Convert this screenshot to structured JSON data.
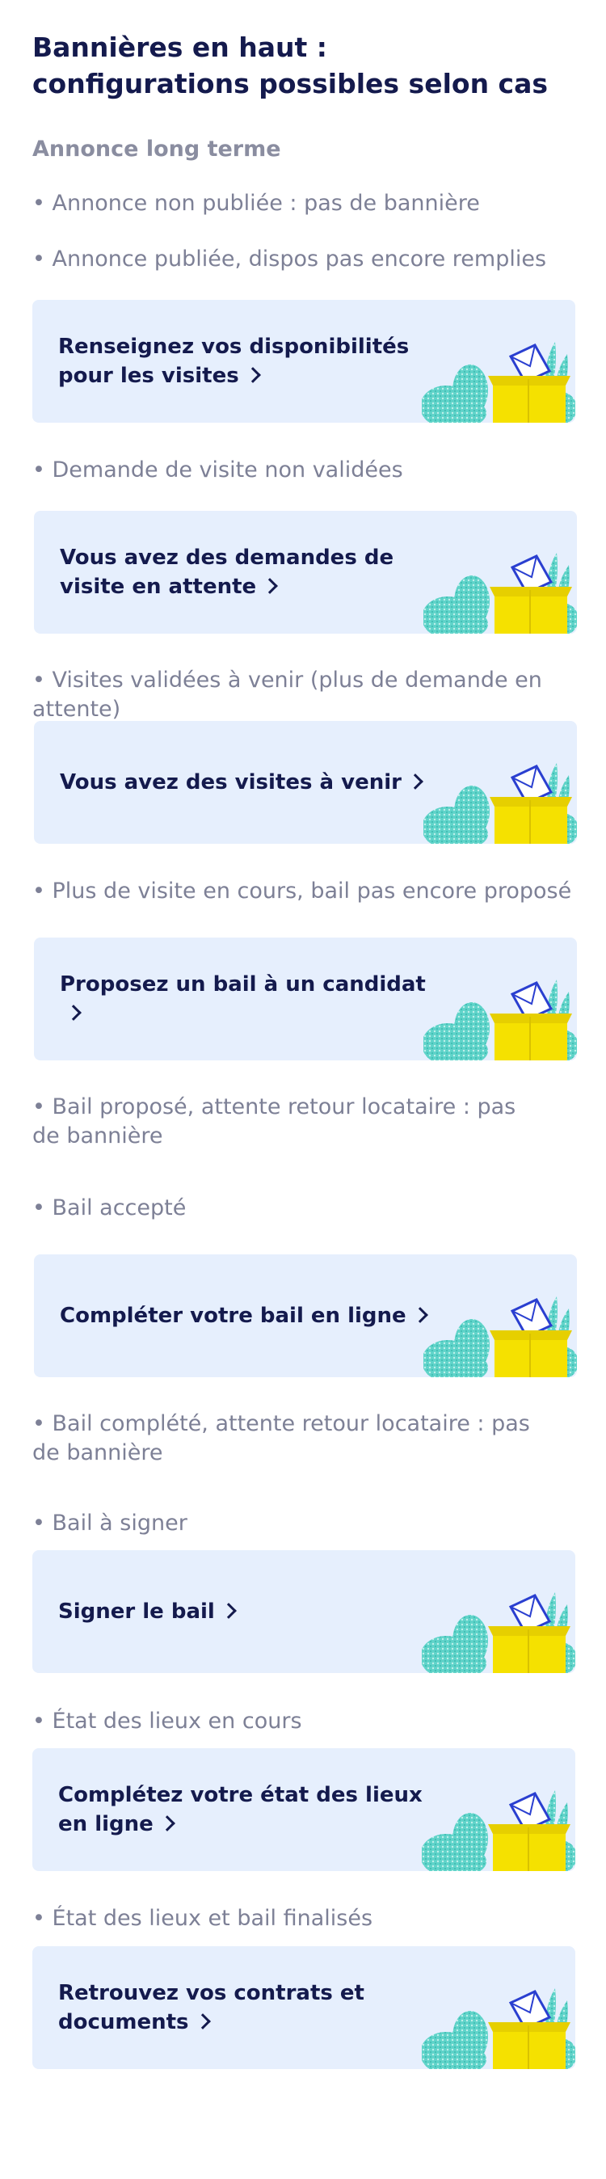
{
  "page": {
    "title": "Bannières en haut : configurations possibles selon cas",
    "subtitle": "Annonce long terme"
  },
  "notes": {
    "n1": "• Annonce non publiée : pas de bannière",
    "n2": "• Annonce publiée, dispos pas encore remplies",
    "n3": "• Demande de visite non validées",
    "n4": "• Visites validées à venir (plus de demande en attente)",
    "n5": "• Plus de visite en cours, bail pas encore proposé",
    "n6": "• Bail proposé, attente retour locataire :  pas de bannière",
    "n7": "• Bail accepté",
    "n8": "• Bail complété, attente retour locataire :  pas de bannière",
    "n9": "• Bail à signer",
    "n10": "• État des lieux en cours",
    "n11": "• État des lieux et bail finalisés"
  },
  "banners": {
    "b1": "Renseignez vos disponibilités pour les visites",
    "b2": "Vous avez des demandes de visite en attente",
    "b3": "Vous avez des visites à venir",
    "b4": "Proposez un bail à un candidat",
    "b5": "Compléter votre bail en ligne",
    "b6": "Signer le bail",
    "b7": "Complétez votre état des lieux en ligne",
    "b8": "Retrouvez vos contrats et documents"
  },
  "colors": {
    "banner_bg": "#e6effd",
    "title": "#141a4d",
    "note": "#7d8096",
    "illustration_foliage": "#5fd3c9",
    "illustration_box": "#f5e100",
    "illustration_envelope": "#2a3fd0"
  },
  "icons": {
    "chevron": "chevron-right-icon",
    "illustration": "mailbox-plants-illustration"
  }
}
